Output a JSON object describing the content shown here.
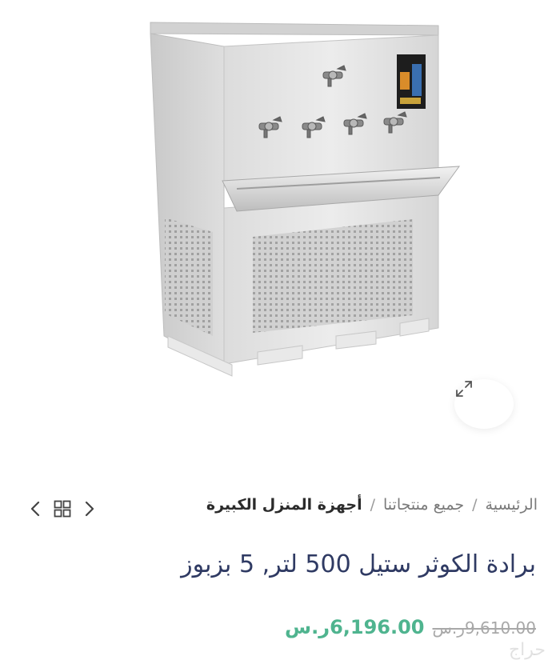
{
  "product_image": {
    "alt_icon": "water-cooler-image",
    "zoom_icon": "expand-icon"
  },
  "breadcrumb": {
    "items": [
      "الرئيسية",
      "جميع منتجاتنا",
      "أجهزة المنزل الكبيرة"
    ],
    "separator": "/"
  },
  "nav": {
    "prev_icon": "chevron-left-icon",
    "grid_icon": "grid-icon",
    "next_icon": "chevron-right-icon"
  },
  "product": {
    "title": "برادة الكوثر ستيل 500 لتر, 5 بزبوز",
    "old_price": "9,610.00ر.س",
    "new_price": "6,196.00ر.س"
  },
  "watermark": "حراج",
  "colors": {
    "title": "#2f3a63",
    "price": "#4fb48f",
    "old_price": "#a8a8a8"
  }
}
